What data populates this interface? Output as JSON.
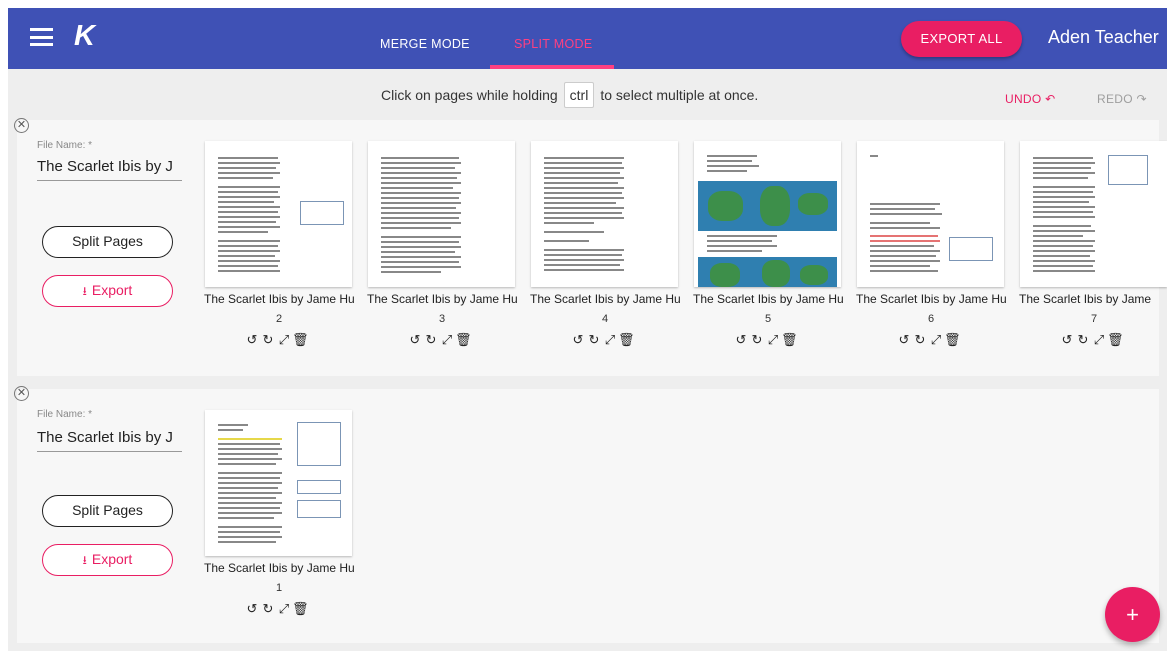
{
  "app": {
    "logo": "K",
    "user_name": "Aden Teacher",
    "export_all_label": "EXPORT ALL",
    "modes": [
      {
        "label": "MERGE MODE",
        "active": false
      },
      {
        "label": "SPLIT MODE",
        "active": true
      }
    ],
    "accent_color": "#e91e63",
    "bar_color": "#3f51b5"
  },
  "toolbar": {
    "instruction_pre": "Click on pages while holding",
    "instruction_key": "ctrl",
    "instruction_post": "to select multiple at once.",
    "undo_label": "UNDO ↶",
    "redo_label": "REDO ↷"
  },
  "files": [
    {
      "field_label": "File Name: *",
      "file_name": "The Scarlet Ibis by J",
      "split_label": "Split Pages",
      "export_label": "Export",
      "pages": [
        {
          "title": "The Scarlet Ibis by Jame Hu",
          "number": "2"
        },
        {
          "title": "The Scarlet Ibis by Jame Hu",
          "number": "3"
        },
        {
          "title": "The Scarlet Ibis by Jame Hu",
          "number": "4"
        },
        {
          "title": "The Scarlet Ibis by Jame Hu",
          "number": "5"
        },
        {
          "title": "The Scarlet Ibis by Jame Hu",
          "number": "6"
        },
        {
          "title": "The Scarlet Ibis by Jame",
          "number": "7"
        }
      ]
    },
    {
      "field_label": "File Name: *",
      "file_name": "The Scarlet Ibis by J",
      "split_label": "Split Pages",
      "export_label": "Export",
      "pages": [
        {
          "title": "The Scarlet Ibis by Jame Hu",
          "number": "1"
        }
      ]
    }
  ],
  "page_actions": {
    "rotate_left": "↺",
    "rotate_right": "↻",
    "expand": "⤢",
    "delete": "🗑"
  },
  "fab_label": "+"
}
